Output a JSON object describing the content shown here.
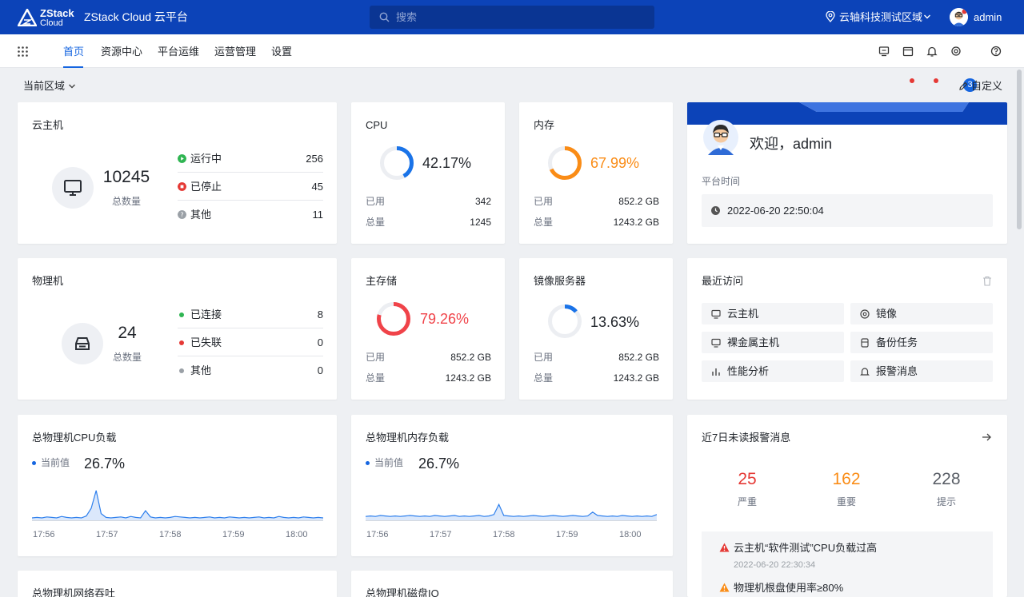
{
  "topbar": {
    "logo_line1": "ZStack",
    "logo_line2": "Cloud",
    "title": "ZStack Cloud 云平台",
    "search_placeholder": "搜索",
    "region": "云轴科技测试区域",
    "user": "admin"
  },
  "nav": {
    "items": [
      {
        "label": "首页",
        "active": true
      },
      {
        "label": "资源中心"
      },
      {
        "label": "平台运维"
      },
      {
        "label": "运营管理"
      },
      {
        "label": "设置"
      }
    ],
    "badge": "3"
  },
  "subheader": {
    "region_label": "当前区域",
    "customize": "自定义"
  },
  "vm": {
    "title": "云主机",
    "total": "10245",
    "total_label": "总数量",
    "rows": [
      {
        "label": "运行中",
        "value": "256"
      },
      {
        "label": "已停止",
        "value": "45"
      },
      {
        "label": "其他",
        "value": "11"
      }
    ]
  },
  "cpu": {
    "title": "CPU",
    "percent": "42.17%",
    "used_label": "已用",
    "used": "342",
    "total_label": "总量",
    "total": "1245"
  },
  "memory": {
    "title": "内存",
    "percent": "67.99%",
    "used_label": "已用",
    "used": "852.2 GB",
    "total_label": "总量",
    "total": "1243.2 GB"
  },
  "welcome": {
    "greeting": "欢迎，admin",
    "time_label": "平台时间",
    "time": "2022-06-20 22:50:04"
  },
  "host": {
    "title": "物理机",
    "total": "24",
    "total_label": "总数量",
    "rows": [
      {
        "label": "已连接",
        "value": "8"
      },
      {
        "label": "已失联",
        "value": "0"
      },
      {
        "label": "其他",
        "value": "0"
      }
    ]
  },
  "primary_storage": {
    "title": "主存储",
    "percent": "79.26%",
    "used_label": "已用",
    "used": "852.2 GB",
    "total_label": "总量",
    "total": "1243.2 GB"
  },
  "image_server": {
    "title": "镜像服务器",
    "percent": "13.63%",
    "used_label": "已用",
    "used": "852.2 GB",
    "total_label": "总量",
    "total": "1243.2 GB"
  },
  "recent": {
    "title": "最近访问",
    "items": [
      {
        "label": "云主机",
        "icon": "monitor-icon"
      },
      {
        "label": "镜像",
        "icon": "disc-icon"
      },
      {
        "label": "裸金属主机",
        "icon": "monitor-icon"
      },
      {
        "label": "备份任务",
        "icon": "database-icon"
      },
      {
        "label": "性能分析",
        "icon": "bar-chart-icon"
      },
      {
        "label": "报警消息",
        "icon": "bell-icon"
      }
    ]
  },
  "cpu_load": {
    "title": "总物理机CPU负载",
    "current_label": "当前值",
    "current": "26.7%"
  },
  "mem_load": {
    "title": "总物理机内存负载",
    "current_label": "当前值",
    "current": "26.7%"
  },
  "alarms": {
    "title": "近7日未读报警消息",
    "critical": "25",
    "critical_label": "严重",
    "major": "162",
    "major_label": "重要",
    "info": "228",
    "info_label": "提示",
    "items": [
      {
        "text": "云主机“软件测试”CPU负载过高",
        "time": "2022-06-20 22:30:34"
      },
      {
        "text": "物理机根盘使用率≥80%"
      }
    ]
  },
  "bottom": {
    "network_title": "总物理机网络吞吐",
    "disk_title": "总物理机磁盘IO"
  },
  "chart_data": [
    {
      "type": "area",
      "title": "总物理机CPU负载",
      "x": [
        "17:56",
        "17:57",
        "17:58",
        "17:59",
        "18:00"
      ],
      "ylim": [
        0,
        100
      ],
      "series": [
        {
          "values": [
            5,
            6,
            5,
            7,
            6,
            5,
            8,
            6,
            5,
            6,
            5,
            9,
            25,
            62,
            14,
            6,
            5,
            6,
            7,
            5,
            8,
            6,
            5,
            20,
            7,
            5,
            6,
            5,
            6,
            8,
            7,
            6,
            5,
            6,
            5,
            6,
            7,
            5,
            6,
            5,
            7,
            6,
            5,
            6,
            5,
            6,
            7,
            5,
            6,
            5,
            8,
            6,
            5,
            6,
            5,
            7,
            6,
            5,
            6,
            5
          ]
        }
      ]
    },
    {
      "type": "area",
      "title": "总物理机内存负载",
      "x": [
        "17:56",
        "17:57",
        "17:58",
        "17:59",
        "18:00"
      ],
      "ylim": [
        0,
        100
      ],
      "series": [
        {
          "values": [
            8,
            9,
            8,
            10,
            9,
            8,
            9,
            8,
            9,
            10,
            9,
            8,
            9,
            8,
            10,
            9,
            8,
            9,
            10,
            8,
            9,
            8,
            9,
            10,
            8,
            9,
            12,
            33,
            10,
            9,
            8,
            9,
            8,
            9,
            10,
            9,
            8,
            9,
            10,
            9,
            8,
            9,
            10,
            9,
            8,
            9,
            17,
            10,
            9,
            8,
            9,
            8,
            10,
            9,
            8,
            9,
            8,
            9,
            8,
            12
          ]
        }
      ]
    }
  ]
}
